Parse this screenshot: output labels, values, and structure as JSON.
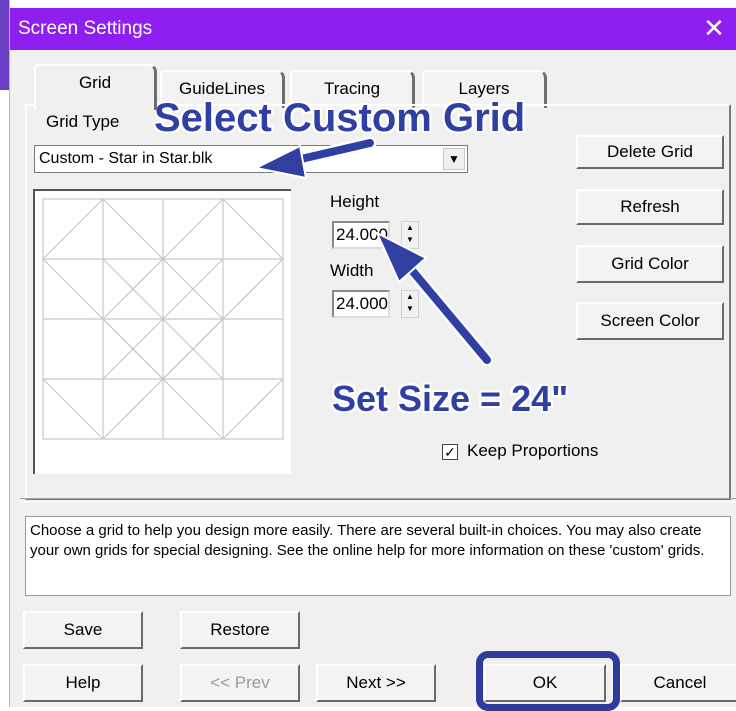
{
  "window": {
    "title": "Screen Settings",
    "close_glyph": "✕"
  },
  "tabs": [
    {
      "label": "Grid",
      "active": true
    },
    {
      "label": "GuideLines",
      "active": false
    },
    {
      "label": "Tracing",
      "active": false
    },
    {
      "label": "Layers",
      "active": false
    }
  ],
  "grid_type": {
    "label": "Grid Type",
    "value": "Custom - Star in Star.blk",
    "arrow": "▼"
  },
  "height": {
    "label": "Height",
    "value": "24.000"
  },
  "width": {
    "label": "Width",
    "value": "24.000"
  },
  "keep_proportions": {
    "label": "Keep Proportions",
    "checked": true,
    "mark": "✓"
  },
  "side_buttons": {
    "delete_grid": "Delete Grid",
    "refresh": "Refresh",
    "grid_color": "Grid Color",
    "screen_color": "Screen Color"
  },
  "help_text": "Choose a grid to help you design more easily. There are several built-in choices. You may also create your own grids for special designing. See the online help for more information on these 'custom' grids.",
  "bottom_buttons": {
    "save": "Save",
    "restore": "Restore",
    "help": "Help",
    "prev": "<< Prev",
    "next": "Next >>",
    "ok": "OK",
    "cancel": "Cancel"
  },
  "annotations": {
    "select_custom_grid": "Select Custom Grid",
    "set_size": "Set Size = 24\""
  },
  "colors": {
    "title_bar": "#8f1ff0",
    "annotation": "#2f3fa2",
    "dialog_bg": "#f0f0f0"
  },
  "icons": [
    "close-icon",
    "dropdown-arrow-icon",
    "spin-up-icon",
    "spin-down-icon",
    "checkmark-icon",
    "arrow-icon"
  ]
}
